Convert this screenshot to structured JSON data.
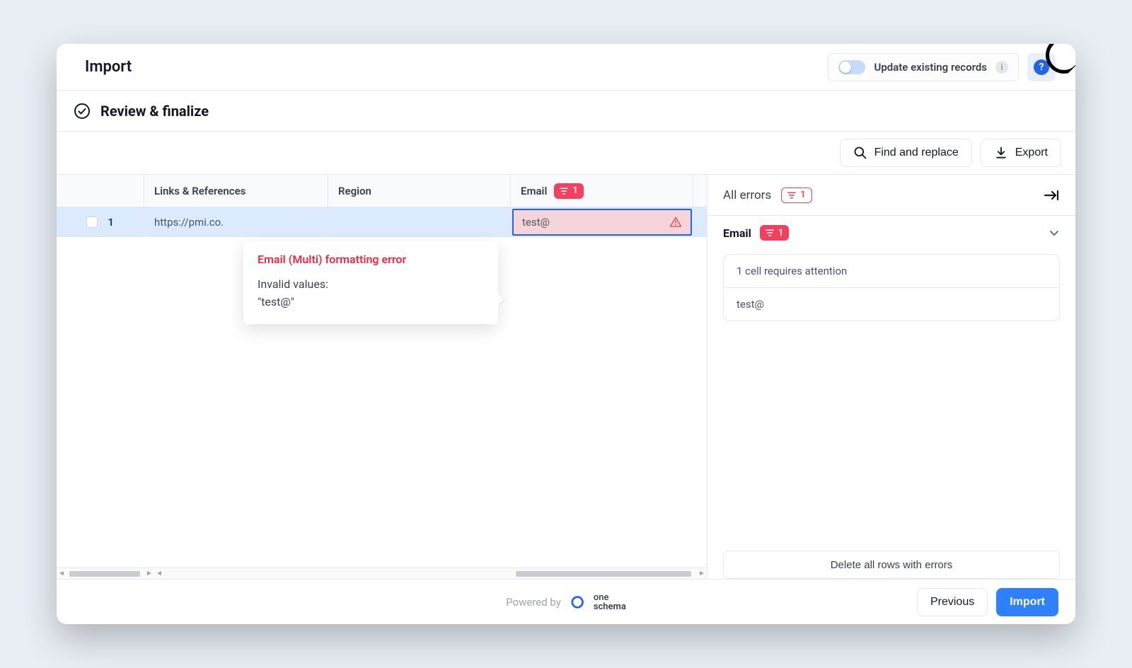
{
  "topbar": {
    "title": "Import",
    "update_label": "Update existing records"
  },
  "step": {
    "title": "Review & finalize"
  },
  "actions": {
    "find_replace": "Find and replace",
    "export": "Export"
  },
  "grid": {
    "columns": {
      "links": "Links & References",
      "region": "Region",
      "email": "Email"
    },
    "email_error_count": "1",
    "rows": [
      {
        "num": "1",
        "links": "https://pmi.co.",
        "region": "",
        "email": "test@"
      }
    ]
  },
  "tooltip": {
    "title": "Email (Multi) formatting error",
    "body_label": "Invalid values:",
    "body_value": "\"test@\""
  },
  "side": {
    "all_errors": "All errors",
    "all_errors_count": "1",
    "group_label": "Email",
    "group_count": "1",
    "card_top": "1 cell requires attention",
    "card_value": "test@",
    "delete_btn": "Delete all rows with errors"
  },
  "footer": {
    "powered_by": "Powered by",
    "brand_l1": "one",
    "brand_l2": "schema",
    "prev": "Previous",
    "import": "Import"
  }
}
